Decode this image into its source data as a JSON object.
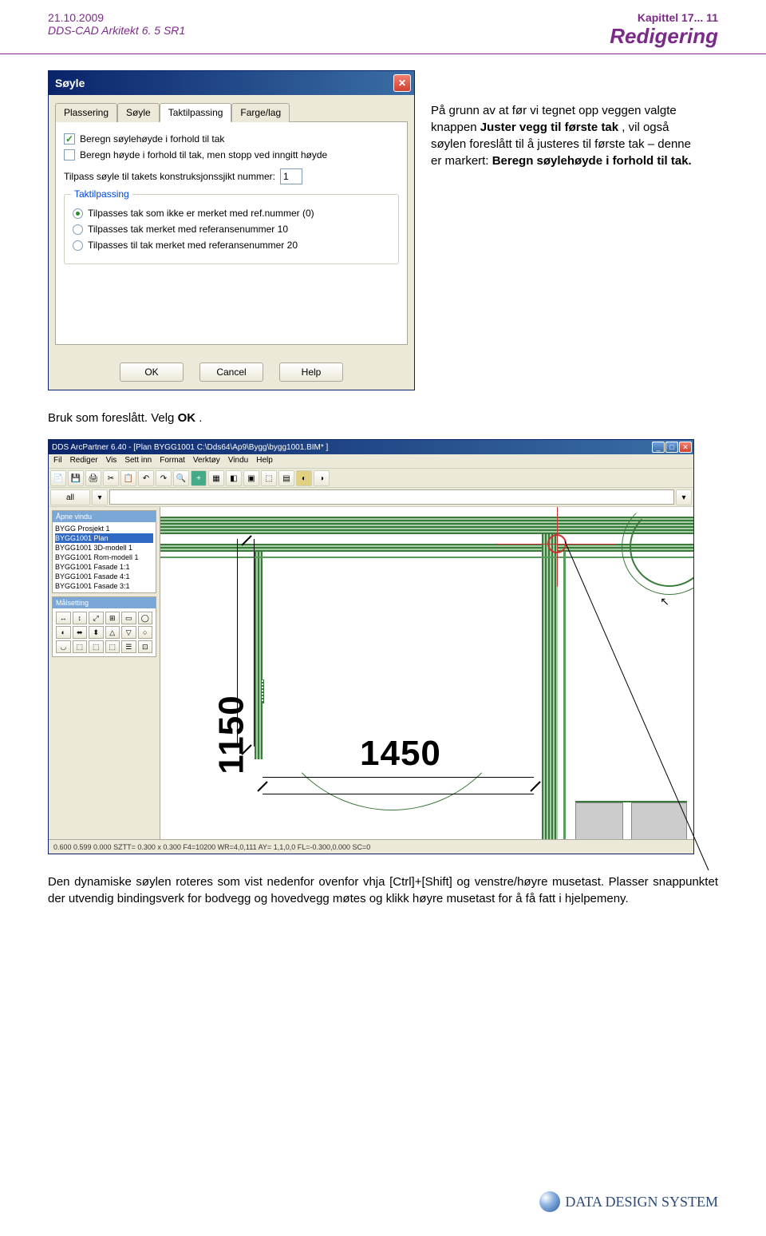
{
  "header": {
    "date": "21.10.2009",
    "product": "DDS-CAD Arkitekt  6. 5 SR1",
    "chapter": "Kapittel 17... 11",
    "title": "Redigering"
  },
  "dialog": {
    "title": "Søyle",
    "close": "✕",
    "tabs": [
      "Plassering",
      "Søyle",
      "Taktilpassing",
      "Farge/lag"
    ],
    "active_tab": "Taktilpassing",
    "checkbox1_checked": true,
    "checkbox1_label": "Beregn søylehøyde i forhold til tak",
    "checkbox2_checked": false,
    "checkbox2_label": "Beregn høyde i forhold til tak, men stopp ved inngitt høyde",
    "field_label": "Tilpass søyle til takets konstruksjonssjikt nummer:",
    "field_value": "1",
    "fieldset_legend": "Taktilpassing",
    "radios": [
      {
        "checked": true,
        "label": "Tilpasses tak som ikke er merket med ref.nummer (0)"
      },
      {
        "checked": false,
        "label": "Tilpasses tak merket med referansenummer 10"
      },
      {
        "checked": false,
        "label": "Tilpasses til tak merket med referansenummer 20"
      }
    ],
    "buttons": {
      "ok": "OK",
      "cancel": "Cancel",
      "help": "Help"
    }
  },
  "para_right_1": "På grunn av at før vi tegnet opp veggen valgte knappen ",
  "para_right_bold1": "Juster vegg til første tak",
  "para_right_2": ", vil også søylen foreslått til å justeres til første tak – denne er markert: ",
  "para_right_bold2": "Beregn søylehøyde i forhold til tak.",
  "para_mid_1": "Bruk som foreslått. Velg ",
  "para_mid_bold": "OK",
  "para_mid_2": ".",
  "cad": {
    "title": "DDS ArcPartner 6.40 - [Plan  BYGG1001  C:\\Dds64\\Ap9\\Bygg\\bygg1001.BIM* ]",
    "menu": [
      "Fil",
      "Rediger",
      "Vis",
      "Sett inn",
      "Format",
      "Verktøy",
      "Vindu",
      "Help"
    ],
    "toolbar2_dropdown": "all",
    "panel1_title": "Åpne vindu",
    "panel1_items": [
      "BYGG Prosjekt 1",
      "BYGG1001 Plan",
      "BYGG1001 3D-modell 1",
      "BYGG1001 Rom-modell 1",
      "BYGG1001 Fasade 1:1",
      "BYGG1001 Fasade 4:1",
      "BYGG1001 Fasade 3:1"
    ],
    "panel1_selected": "BYGG1001 Plan",
    "panel2_title": "Målsetting",
    "dim1": "1150",
    "dim2": "1450",
    "status": "0.600     0.599     0.000     SZTT= 0.300 x 0.300          F4=10200     WR=4,0,111     AY= 1,1,0,0     FL=-0.300,0.000     SC=0"
  },
  "para_bottom": "Den dynamiske søylen roteres som vist nedenfor ovenfor vhja [Ctrl]+[Shift] og venstre/høyre musetast. Plasser snappunktet der utvendig bindingsverk for bodvegg og hovedvegg møtes og klikk høyre musetast for å få fatt i hjelpemeny.",
  "footer": {
    "logo_text": "DATA DESIGN SYSTEM"
  }
}
